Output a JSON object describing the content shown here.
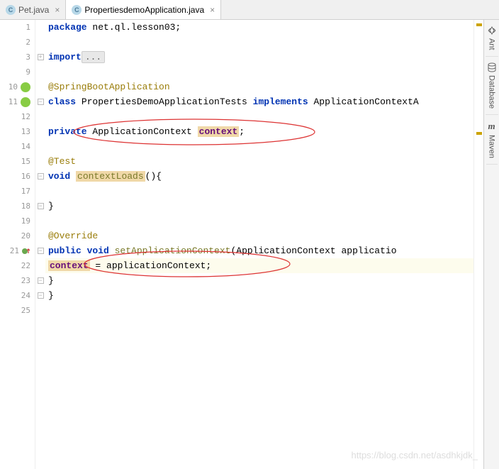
{
  "tabs": [
    {
      "label": "Pet.java",
      "active": false
    },
    {
      "label": "PropertiesdemoApplication.java",
      "active": true
    }
  ],
  "lines": {
    "l1_kw": "package",
    "l1_pkg": " net.ql.lesson03;",
    "l3_kw": "import",
    "l3_dots": "...",
    "l10_ann": "@SpringBootApplication",
    "l11_kw1": "class",
    "l11_name": " PropertiesDemoApplicationTests ",
    "l11_kw2": "implements",
    "l11_rest": " ApplicationContextA",
    "l13_kw": "private",
    "l13_type": " ApplicationContext ",
    "l13_field": "context",
    "l13_semi": ";",
    "l15_ann": "@Test",
    "l16_kw": "void",
    "l16_sp": " ",
    "l16_meth": "contextLoads",
    "l16_rest": "(){",
    "l18_close": "}",
    "l20_ann": "@Override",
    "l21_kw1": "public",
    "l21_kw2": " void",
    "l21_meth": " setApplicationContext",
    "l21_rest": "(ApplicationContext applicatio",
    "l22_field": "context",
    "l22_rest": " = applicationContext;",
    "l23_close": "}",
    "l24_close": "}"
  },
  "gutter_numbers": [
    "1",
    "2",
    "3",
    "9",
    "10",
    "11",
    "12",
    "13",
    "14",
    "15",
    "16",
    "17",
    "18",
    "19",
    "20",
    "21",
    "22",
    "23",
    "24",
    "25"
  ],
  "tools": {
    "ant": "Ant",
    "database": "Database",
    "maven": "Maven"
  },
  "watermark": "https://blog.csdn.net/asdhkjdk_"
}
